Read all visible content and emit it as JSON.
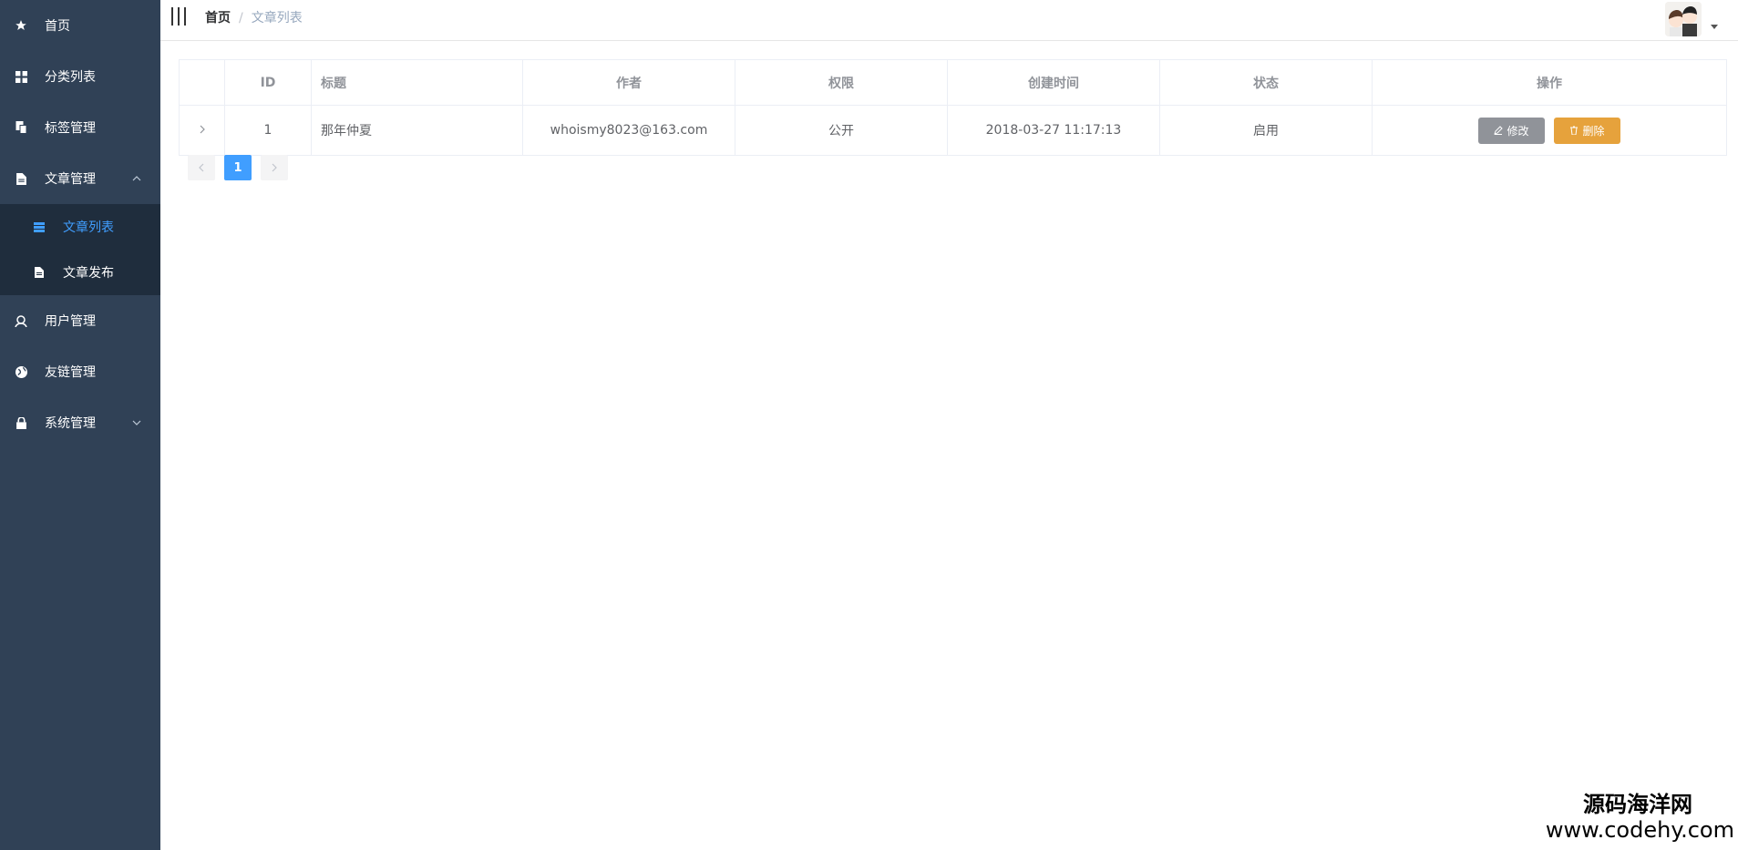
{
  "sidebar": {
    "items": [
      {
        "label": "首页",
        "icon": "star-icon"
      },
      {
        "label": "分类列表",
        "icon": "grid-icon"
      },
      {
        "label": "标签管理",
        "icon": "copy-icon"
      },
      {
        "label": "文章管理",
        "icon": "document-icon",
        "expanded": true
      },
      {
        "label": "用户管理",
        "icon": "user-icon"
      },
      {
        "label": "友链管理",
        "icon": "globe-icon"
      },
      {
        "label": "系统管理",
        "icon": "lock-icon",
        "expanded": false
      }
    ],
    "submenu": [
      {
        "label": "文章列表",
        "icon": "list-icon",
        "active": true
      },
      {
        "label": "文章发布",
        "icon": "document-icon"
      }
    ]
  },
  "header": {
    "breadcrumb": {
      "home": "首页",
      "separator": "/",
      "current": "文章列表"
    }
  },
  "table": {
    "columns": [
      "ID",
      "标题",
      "作者",
      "权限",
      "创建时间",
      "状态",
      "操作"
    ],
    "rows": [
      {
        "id": "1",
        "title": "那年仲夏",
        "author": "whoismy8023@163.com",
        "permission": "公开",
        "created": "2018-03-27 11:17:13",
        "status": "启用"
      }
    ],
    "actions": {
      "edit": "修改",
      "delete": "删除"
    }
  },
  "pagination": {
    "current_page": "1"
  },
  "watermark": {
    "line1": "源码海洋网",
    "line2": "www.codehy.com"
  },
  "colors": {
    "sidebar_bg": "#304156",
    "submenu_bg": "#1f2d3d",
    "active": "#409eff",
    "edit_button": "#909399",
    "delete_button": "#e6a23c"
  }
}
